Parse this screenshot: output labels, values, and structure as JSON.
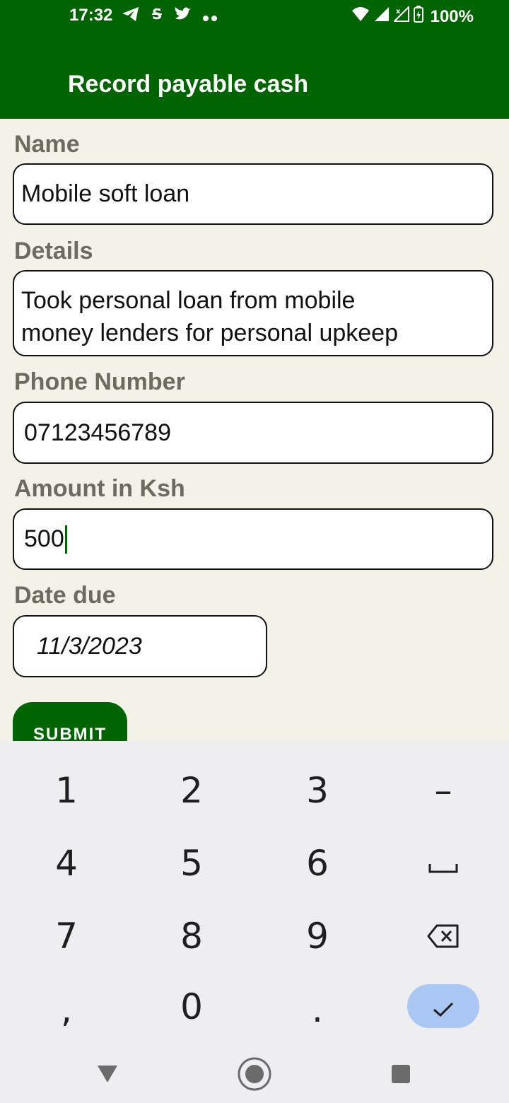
{
  "status_bar": {
    "time": "17:32",
    "battery": "100%",
    "left_icons": [
      "telegram-icon",
      "s-app-icon",
      "twitter-icon",
      "more-notifications-icon"
    ],
    "right_icons": [
      "wifi-icon",
      "signal-icon",
      "signal-no-data-icon",
      "battery-charging-icon"
    ]
  },
  "app_bar": {
    "title": "Record payable cash",
    "background": "#006400"
  },
  "form": {
    "name_label": "Name",
    "name_value": "Mobile soft loan",
    "details_label": "Details",
    "details_line1": "Took personal loan from mobile",
    "details_line2": "money lenders for personal upkeep",
    "phone_label": "Phone Number",
    "phone_value": "07123456789",
    "amount_label": "Amount in Ksh",
    "amount_value": "500",
    "date_label": "Date due",
    "date_value": "11/3/2023",
    "submit_label": "SUBMIT"
  },
  "keyboard": {
    "rows": [
      [
        "1",
        "2",
        "3",
        "–"
      ],
      [
        "4",
        "5",
        "6",
        "space"
      ],
      [
        "7",
        "8",
        "9",
        "backspace"
      ],
      [
        ",",
        "0",
        ".",
        "done"
      ]
    ],
    "done_color": "#a9c7f2"
  },
  "nav_bar": {
    "buttons": [
      "back-icon",
      "home-icon",
      "recents-icon"
    ]
  }
}
